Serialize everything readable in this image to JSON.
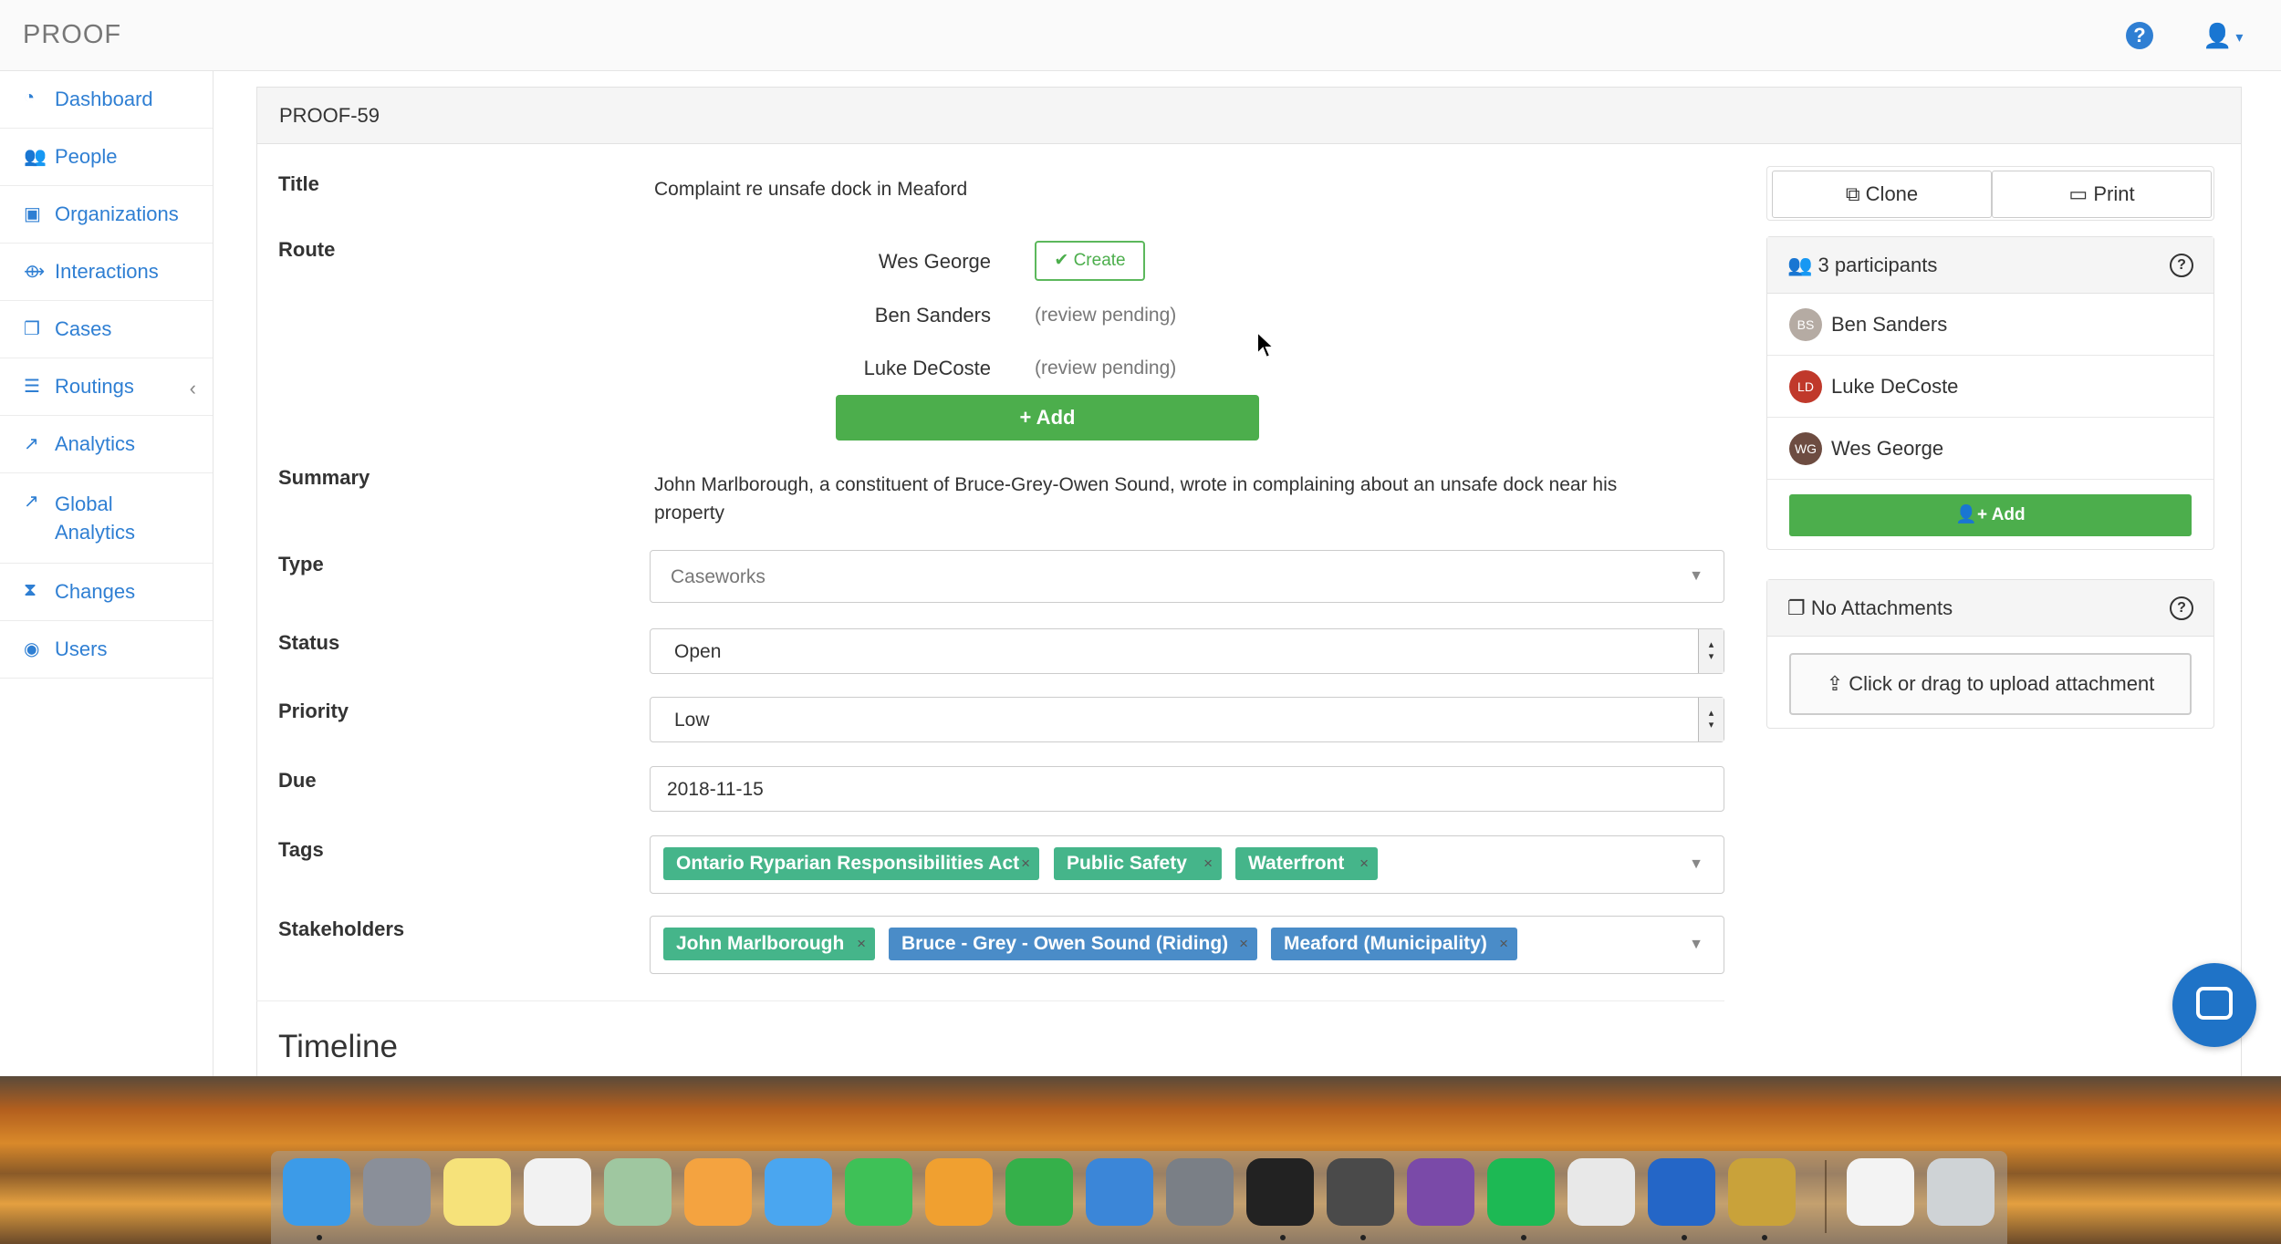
{
  "app": {
    "brand": "PROOF"
  },
  "topbar": {
    "help_glyph": "?",
    "user_glyph": "👤"
  },
  "sidebar": {
    "items": [
      {
        "label": "Dashboard",
        "icon": "dashboard-icon",
        "glyph": "◔"
      },
      {
        "label": "People",
        "icon": "users-icon",
        "glyph": "👥"
      },
      {
        "label": "Organizations",
        "icon": "briefcase-icon",
        "glyph": "▣"
      },
      {
        "label": "Interactions",
        "icon": "handshake-icon",
        "glyph": "⟴"
      },
      {
        "label": "Cases",
        "icon": "files-icon",
        "glyph": "❐"
      },
      {
        "label": "Routings",
        "icon": "list-icon",
        "glyph": "☰",
        "chevron": "‹"
      },
      {
        "label": "Analytics",
        "icon": "line-chart-icon",
        "glyph": "↗"
      },
      {
        "label": "Global Analytics",
        "icon": "line-chart-icon",
        "glyph": "↗"
      },
      {
        "label": "Changes",
        "icon": "hourglass-icon",
        "glyph": "⧗"
      },
      {
        "label": "Users",
        "icon": "user-circle-icon",
        "glyph": "◉"
      }
    ]
  },
  "case": {
    "id": "PROOF-59",
    "fields": {
      "title_label": "Title",
      "title_value": "Complaint re unsafe dock in Meaford",
      "route_label": "Route",
      "summary_label": "Summary",
      "summary_value": "John Marlborough, a constituent of Bruce-Grey-Owen Sound, wrote in complaining about an unsafe dock near his property",
      "type_label": "Type",
      "type_value": "Caseworks",
      "status_label": "Status",
      "status_value": "Open",
      "priority_label": "Priority",
      "priority_value": "Low",
      "due_label": "Due",
      "due_value": "2018-11-15",
      "tags_label": "Tags",
      "stakeholders_label": "Stakeholders"
    },
    "route": [
      {
        "name": "Wes George",
        "status": ""
      },
      {
        "name": "Ben Sanders",
        "status": "(review pending)"
      },
      {
        "name": "Luke DeCoste",
        "status": "(review pending)"
      }
    ],
    "route_create_label": "✔ Create",
    "route_add_label": "+ Add",
    "tags": [
      "Ontario Ryparian Responsibilities Act",
      "Public Safety",
      "Waterfront"
    ],
    "stakeholders": [
      {
        "name": "John Marlborough",
        "color": "#45b58a"
      },
      {
        "name": "Bruce - Grey - Owen Sound (Riding)",
        "color": "#4a8cc8"
      },
      {
        "name": "Meaford (Municipality)",
        "color": "#4a8cc8"
      }
    ],
    "remove_glyph": "×",
    "timeline_heading": "Timeline"
  },
  "actions": {
    "clone_label": "Clone",
    "print_label": "Print"
  },
  "participants": {
    "header": "3 participants",
    "people": [
      {
        "initials": "BS",
        "name": "Ben Sanders",
        "color": "#b5aba3"
      },
      {
        "initials": "LD",
        "name": "Luke DeCoste",
        "color": "#c0392b"
      },
      {
        "initials": "WG",
        "name": "Wes George",
        "color": "#6d4c41"
      }
    ],
    "add_label": "Add"
  },
  "attachments": {
    "header": "No Attachments",
    "upload_label": "Click or drag to upload attachment"
  },
  "dock": {
    "apps": [
      {
        "name": "finder",
        "color": "#3c9be8"
      },
      {
        "name": "launchpad",
        "color": "#8a8f99"
      },
      {
        "name": "notes",
        "color": "#f6e27a"
      },
      {
        "name": "reminders",
        "color": "#f2f2f2"
      },
      {
        "name": "maps",
        "color": "#9fc7a0"
      },
      {
        "name": "photos",
        "color": "#f4a340"
      },
      {
        "name": "messages",
        "color": "#4aa6f0"
      },
      {
        "name": "facetime",
        "color": "#3ec157"
      },
      {
        "name": "pages",
        "color": "#f0a030"
      },
      {
        "name": "numbers",
        "color": "#35b04a"
      },
      {
        "name": "keynote",
        "color": "#3b86d8"
      },
      {
        "name": "system-preferences",
        "color": "#7a7f86"
      },
      {
        "name": "terminal",
        "color": "#222222"
      },
      {
        "name": "sublime-text",
        "color": "#4a4a4a"
      },
      {
        "name": "dash",
        "color": "#7a4aa8"
      },
      {
        "name": "spotify",
        "color": "#1db954"
      },
      {
        "name": "slack",
        "color": "#e8e8e8"
      },
      {
        "name": "firefox",
        "color": "#2466c7"
      },
      {
        "name": "keychain",
        "color": "#c9a23a"
      },
      {
        "name": "text-document",
        "color": "#f3f3f3"
      },
      {
        "name": "trash",
        "color": "#cfd3d6"
      }
    ]
  }
}
